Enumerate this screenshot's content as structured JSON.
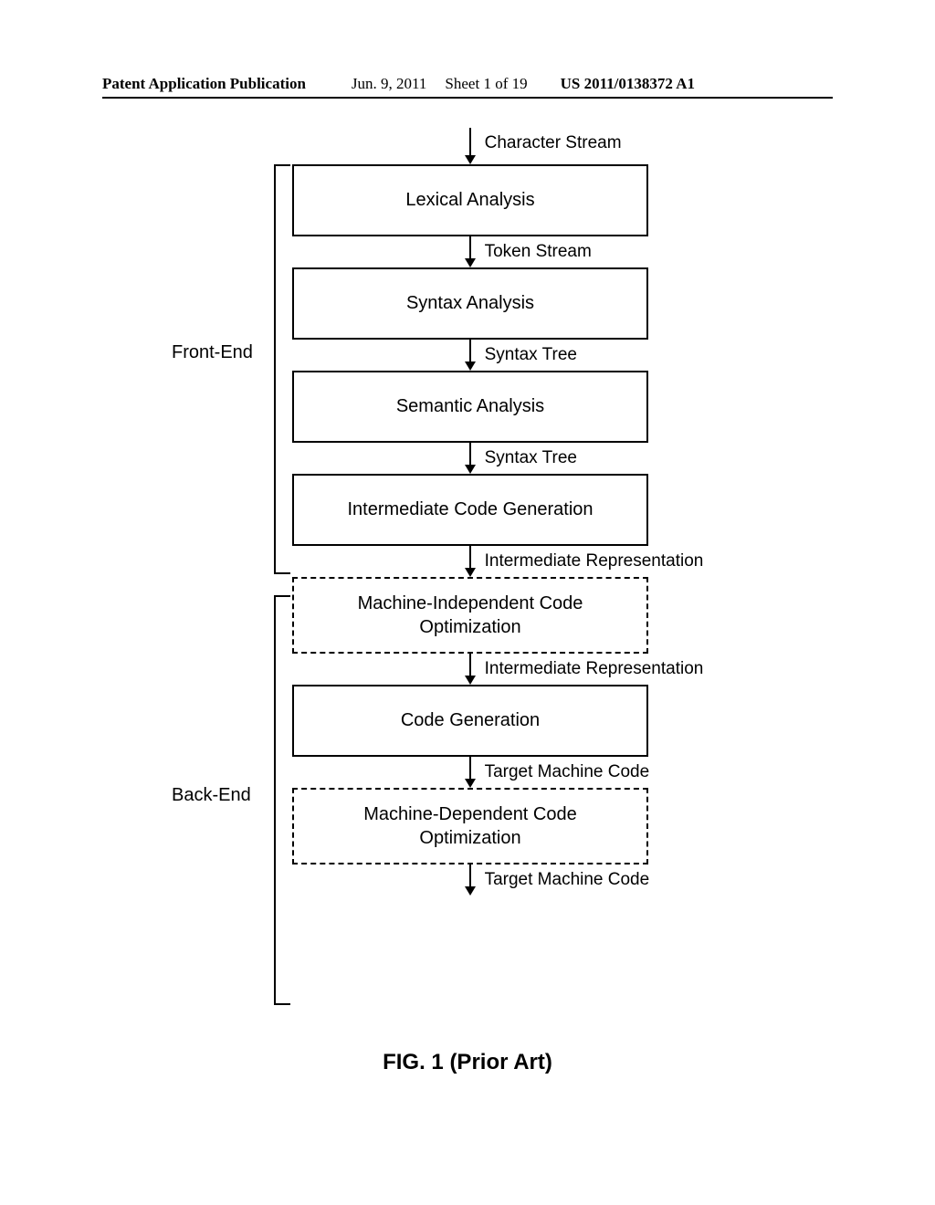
{
  "header": {
    "pub": "Patent Application Publication",
    "date": "Jun. 9, 2011",
    "sheet": "Sheet 1 of 19",
    "pubnum": "US 2011/0138372 A1"
  },
  "labels": {
    "front_end": "Front-End",
    "back_end": "Back-End"
  },
  "arrows": {
    "a0": "Character Stream",
    "a1": "Token Stream",
    "a2": "Syntax Tree",
    "a3": "Syntax Tree",
    "a4": "Intermediate Representation",
    "a5": "Intermediate Representation",
    "a6": "Target Machine Code",
    "a7": "Target Machine Code"
  },
  "boxes": {
    "b0": "Lexical Analysis",
    "b1": "Syntax Analysis",
    "b2": "Semantic Analysis",
    "b3": "Intermediate Code Generation",
    "b4a": "Machine-Independent Code",
    "b4b": "Optimization",
    "b5": "Code Generation",
    "b6a": "Machine-Dependent Code",
    "b6b": "Optimization"
  },
  "figure_caption": "FIG. 1 (Prior Art)"
}
